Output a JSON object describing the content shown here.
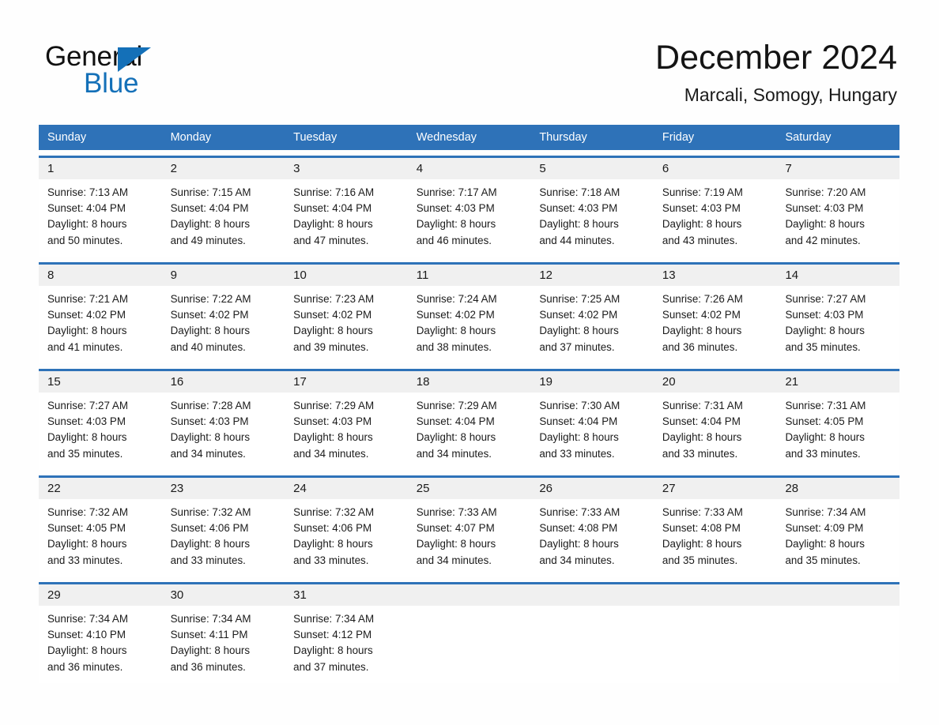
{
  "brand": {
    "name_part1": "General",
    "name_part2": "Blue",
    "triangle_color": "#1470b8",
    "text_color": "#101010"
  },
  "header": {
    "title": "December 2024",
    "subtitle": "Marcali, Somogy, Hungary",
    "accent_color": "#2e72b8",
    "datebar_color": "#f0f0f0"
  },
  "calendar": {
    "weekdays": [
      "Sunday",
      "Monday",
      "Tuesday",
      "Wednesday",
      "Thursday",
      "Friday",
      "Saturday"
    ],
    "weeks": [
      {
        "days": [
          {
            "num": "1",
            "sunrise": "Sunrise: 7:13 AM",
            "sunset": "Sunset: 4:04 PM",
            "daylight1": "Daylight: 8 hours",
            "daylight2": "and 50 minutes."
          },
          {
            "num": "2",
            "sunrise": "Sunrise: 7:15 AM",
            "sunset": "Sunset: 4:04 PM",
            "daylight1": "Daylight: 8 hours",
            "daylight2": "and 49 minutes."
          },
          {
            "num": "3",
            "sunrise": "Sunrise: 7:16 AM",
            "sunset": "Sunset: 4:04 PM",
            "daylight1": "Daylight: 8 hours",
            "daylight2": "and 47 minutes."
          },
          {
            "num": "4",
            "sunrise": "Sunrise: 7:17 AM",
            "sunset": "Sunset: 4:03 PM",
            "daylight1": "Daylight: 8 hours",
            "daylight2": "and 46 minutes."
          },
          {
            "num": "5",
            "sunrise": "Sunrise: 7:18 AM",
            "sunset": "Sunset: 4:03 PM",
            "daylight1": "Daylight: 8 hours",
            "daylight2": "and 44 minutes."
          },
          {
            "num": "6",
            "sunrise": "Sunrise: 7:19 AM",
            "sunset": "Sunset: 4:03 PM",
            "daylight1": "Daylight: 8 hours",
            "daylight2": "and 43 minutes."
          },
          {
            "num": "7",
            "sunrise": "Sunrise: 7:20 AM",
            "sunset": "Sunset: 4:03 PM",
            "daylight1": "Daylight: 8 hours",
            "daylight2": "and 42 minutes."
          }
        ]
      },
      {
        "days": [
          {
            "num": "8",
            "sunrise": "Sunrise: 7:21 AM",
            "sunset": "Sunset: 4:02 PM",
            "daylight1": "Daylight: 8 hours",
            "daylight2": "and 41 minutes."
          },
          {
            "num": "9",
            "sunrise": "Sunrise: 7:22 AM",
            "sunset": "Sunset: 4:02 PM",
            "daylight1": "Daylight: 8 hours",
            "daylight2": "and 40 minutes."
          },
          {
            "num": "10",
            "sunrise": "Sunrise: 7:23 AM",
            "sunset": "Sunset: 4:02 PM",
            "daylight1": "Daylight: 8 hours",
            "daylight2": "and 39 minutes."
          },
          {
            "num": "11",
            "sunrise": "Sunrise: 7:24 AM",
            "sunset": "Sunset: 4:02 PM",
            "daylight1": "Daylight: 8 hours",
            "daylight2": "and 38 minutes."
          },
          {
            "num": "12",
            "sunrise": "Sunrise: 7:25 AM",
            "sunset": "Sunset: 4:02 PM",
            "daylight1": "Daylight: 8 hours",
            "daylight2": "and 37 minutes."
          },
          {
            "num": "13",
            "sunrise": "Sunrise: 7:26 AM",
            "sunset": "Sunset: 4:02 PM",
            "daylight1": "Daylight: 8 hours",
            "daylight2": "and 36 minutes."
          },
          {
            "num": "14",
            "sunrise": "Sunrise: 7:27 AM",
            "sunset": "Sunset: 4:03 PM",
            "daylight1": "Daylight: 8 hours",
            "daylight2": "and 35 minutes."
          }
        ]
      },
      {
        "days": [
          {
            "num": "15",
            "sunrise": "Sunrise: 7:27 AM",
            "sunset": "Sunset: 4:03 PM",
            "daylight1": "Daylight: 8 hours",
            "daylight2": "and 35 minutes."
          },
          {
            "num": "16",
            "sunrise": "Sunrise: 7:28 AM",
            "sunset": "Sunset: 4:03 PM",
            "daylight1": "Daylight: 8 hours",
            "daylight2": "and 34 minutes."
          },
          {
            "num": "17",
            "sunrise": "Sunrise: 7:29 AM",
            "sunset": "Sunset: 4:03 PM",
            "daylight1": "Daylight: 8 hours",
            "daylight2": "and 34 minutes."
          },
          {
            "num": "18",
            "sunrise": "Sunrise: 7:29 AM",
            "sunset": "Sunset: 4:04 PM",
            "daylight1": "Daylight: 8 hours",
            "daylight2": "and 34 minutes."
          },
          {
            "num": "19",
            "sunrise": "Sunrise: 7:30 AM",
            "sunset": "Sunset: 4:04 PM",
            "daylight1": "Daylight: 8 hours",
            "daylight2": "and 33 minutes."
          },
          {
            "num": "20",
            "sunrise": "Sunrise: 7:31 AM",
            "sunset": "Sunset: 4:04 PM",
            "daylight1": "Daylight: 8 hours",
            "daylight2": "and 33 minutes."
          },
          {
            "num": "21",
            "sunrise": "Sunrise: 7:31 AM",
            "sunset": "Sunset: 4:05 PM",
            "daylight1": "Daylight: 8 hours",
            "daylight2": "and 33 minutes."
          }
        ]
      },
      {
        "days": [
          {
            "num": "22",
            "sunrise": "Sunrise: 7:32 AM",
            "sunset": "Sunset: 4:05 PM",
            "daylight1": "Daylight: 8 hours",
            "daylight2": "and 33 minutes."
          },
          {
            "num": "23",
            "sunrise": "Sunrise: 7:32 AM",
            "sunset": "Sunset: 4:06 PM",
            "daylight1": "Daylight: 8 hours",
            "daylight2": "and 33 minutes."
          },
          {
            "num": "24",
            "sunrise": "Sunrise: 7:32 AM",
            "sunset": "Sunset: 4:06 PM",
            "daylight1": "Daylight: 8 hours",
            "daylight2": "and 33 minutes."
          },
          {
            "num": "25",
            "sunrise": "Sunrise: 7:33 AM",
            "sunset": "Sunset: 4:07 PM",
            "daylight1": "Daylight: 8 hours",
            "daylight2": "and 34 minutes."
          },
          {
            "num": "26",
            "sunrise": "Sunrise: 7:33 AM",
            "sunset": "Sunset: 4:08 PM",
            "daylight1": "Daylight: 8 hours",
            "daylight2": "and 34 minutes."
          },
          {
            "num": "27",
            "sunrise": "Sunrise: 7:33 AM",
            "sunset": "Sunset: 4:08 PM",
            "daylight1": "Daylight: 8 hours",
            "daylight2": "and 35 minutes."
          },
          {
            "num": "28",
            "sunrise": "Sunrise: 7:34 AM",
            "sunset": "Sunset: 4:09 PM",
            "daylight1": "Daylight: 8 hours",
            "daylight2": "and 35 minutes."
          }
        ]
      },
      {
        "days": [
          {
            "num": "29",
            "sunrise": "Sunrise: 7:34 AM",
            "sunset": "Sunset: 4:10 PM",
            "daylight1": "Daylight: 8 hours",
            "daylight2": "and 36 minutes."
          },
          {
            "num": "30",
            "sunrise": "Sunrise: 7:34 AM",
            "sunset": "Sunset: 4:11 PM",
            "daylight1": "Daylight: 8 hours",
            "daylight2": "and 36 minutes."
          },
          {
            "num": "31",
            "sunrise": "Sunrise: 7:34 AM",
            "sunset": "Sunset: 4:12 PM",
            "daylight1": "Daylight: 8 hours",
            "daylight2": "and 37 minutes."
          },
          {
            "num": "",
            "sunrise": "",
            "sunset": "",
            "daylight1": "",
            "daylight2": ""
          },
          {
            "num": "",
            "sunrise": "",
            "sunset": "",
            "daylight1": "",
            "daylight2": ""
          },
          {
            "num": "",
            "sunrise": "",
            "sunset": "",
            "daylight1": "",
            "daylight2": ""
          },
          {
            "num": "",
            "sunrise": "",
            "sunset": "",
            "daylight1": "",
            "daylight2": ""
          }
        ]
      }
    ]
  }
}
